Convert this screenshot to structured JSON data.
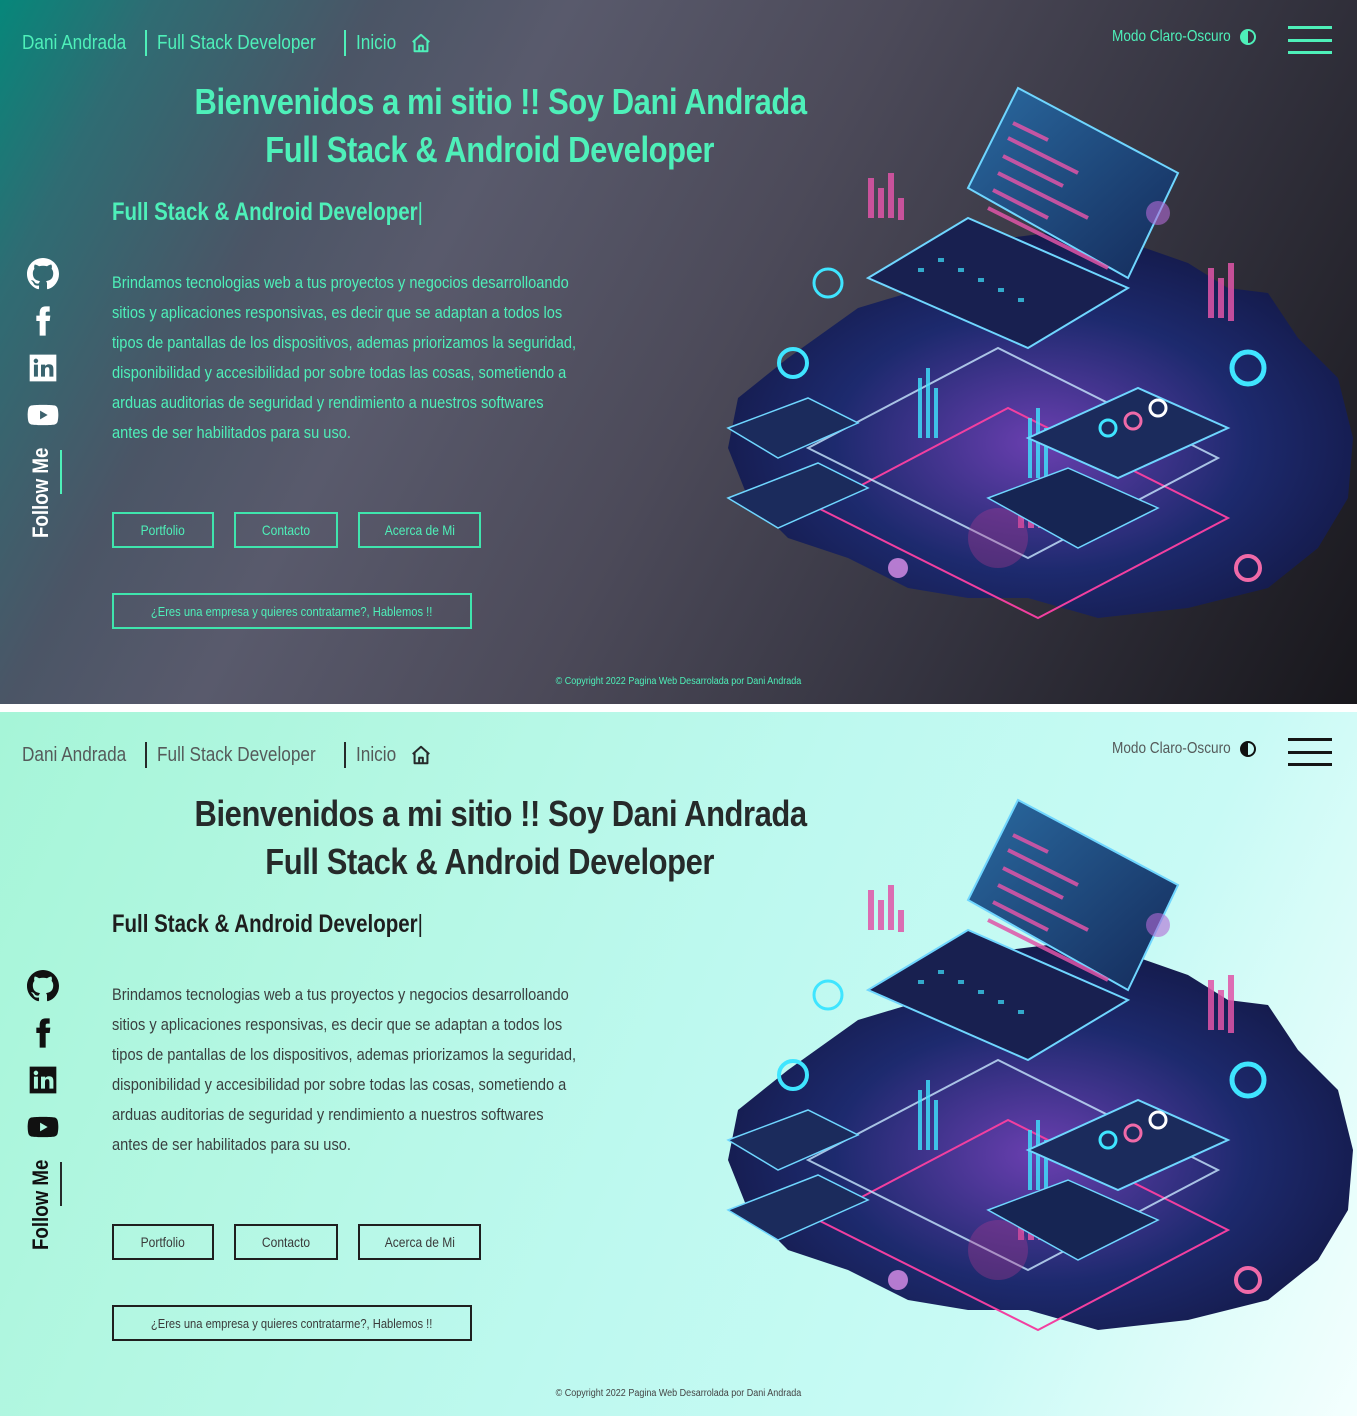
{
  "themes": [
    {
      "name": "dark",
      "colors": {
        "accent": "#4ef0b9",
        "bg_start": "#06877a",
        "bg_end": "#18171c",
        "icons": "#ffffff"
      }
    },
    {
      "name": "light",
      "colors": {
        "accent": "#262a2a",
        "bg_start": "#a6f5d8",
        "bg_end": "#f4fffe",
        "icons": "#111111"
      }
    }
  ],
  "nav": {
    "name": "Dani Andrada",
    "role": "Full Stack Developer",
    "home": "Inicio",
    "home_icon": "home-icon"
  },
  "mode_toggle": {
    "label": "Modo Claro-Oscuro",
    "icon": "contrast-icon"
  },
  "menu_icon": "hamburger-menu-icon",
  "hero": {
    "title_line1": "Bienvenidos a mi sitio !! Soy Dani Andrada",
    "title_line2": "Full Stack & Android Developer",
    "typed_text": "Full Stack & Android Developer",
    "cursor": "|",
    "description": "Brindamos tecnologias web a tus proyectos y negocios desarrolloando sitios y aplicaciones responsivas, es decir que se adaptan a todos los tipos de pantallas de los dispositivos, ademas priorizamos la seguridad, disponibilidad y accesibilidad por sobre todas las cosas, sometiendo a arduas auditorias de seguridad y rendimiento a nuestros softwares antes de ser habilitados para su uso."
  },
  "buttons": {
    "portfolio": "Portfolio",
    "contacto": "Contacto",
    "acerca": "Acerca de Mi",
    "hire": "¿Eres una empresa y quieres contratarme?, Hablemos !!"
  },
  "social": {
    "icons": [
      "github-icon",
      "facebook-icon",
      "linkedin-icon",
      "youtube-icon"
    ],
    "follow_label": "Follow Me"
  },
  "footer": {
    "copyright": "© Copyright 2022 Pagina Web Desarrolada por Dani Andrada"
  },
  "illustration": {
    "description_icon": "isometric-laptop-illustration"
  }
}
